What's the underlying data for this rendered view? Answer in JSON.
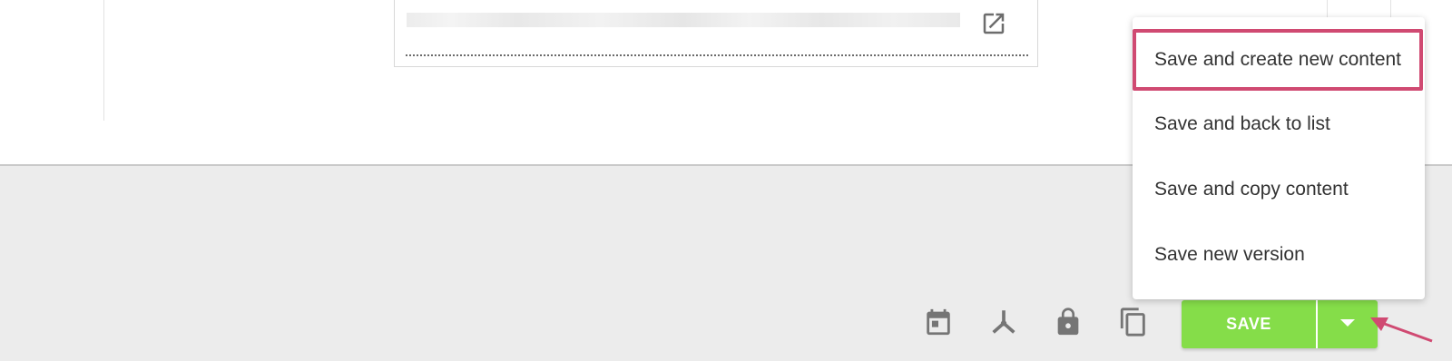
{
  "menu": {
    "items": [
      {
        "label": "Save and create new content"
      },
      {
        "label": "Save and back to list"
      },
      {
        "label": "Save and copy content"
      },
      {
        "label": "Save new version"
      }
    ]
  },
  "toolbar": {
    "save_label": "SAVE",
    "icons": [
      "calendar-icon",
      "workflow-icon",
      "lock-icon",
      "copy-icon"
    ]
  },
  "colors": {
    "save_button": "#85dd49",
    "highlight_border": "#d04a72",
    "annotation_arrow": "#d04a72",
    "icon_gray": "#757575"
  }
}
